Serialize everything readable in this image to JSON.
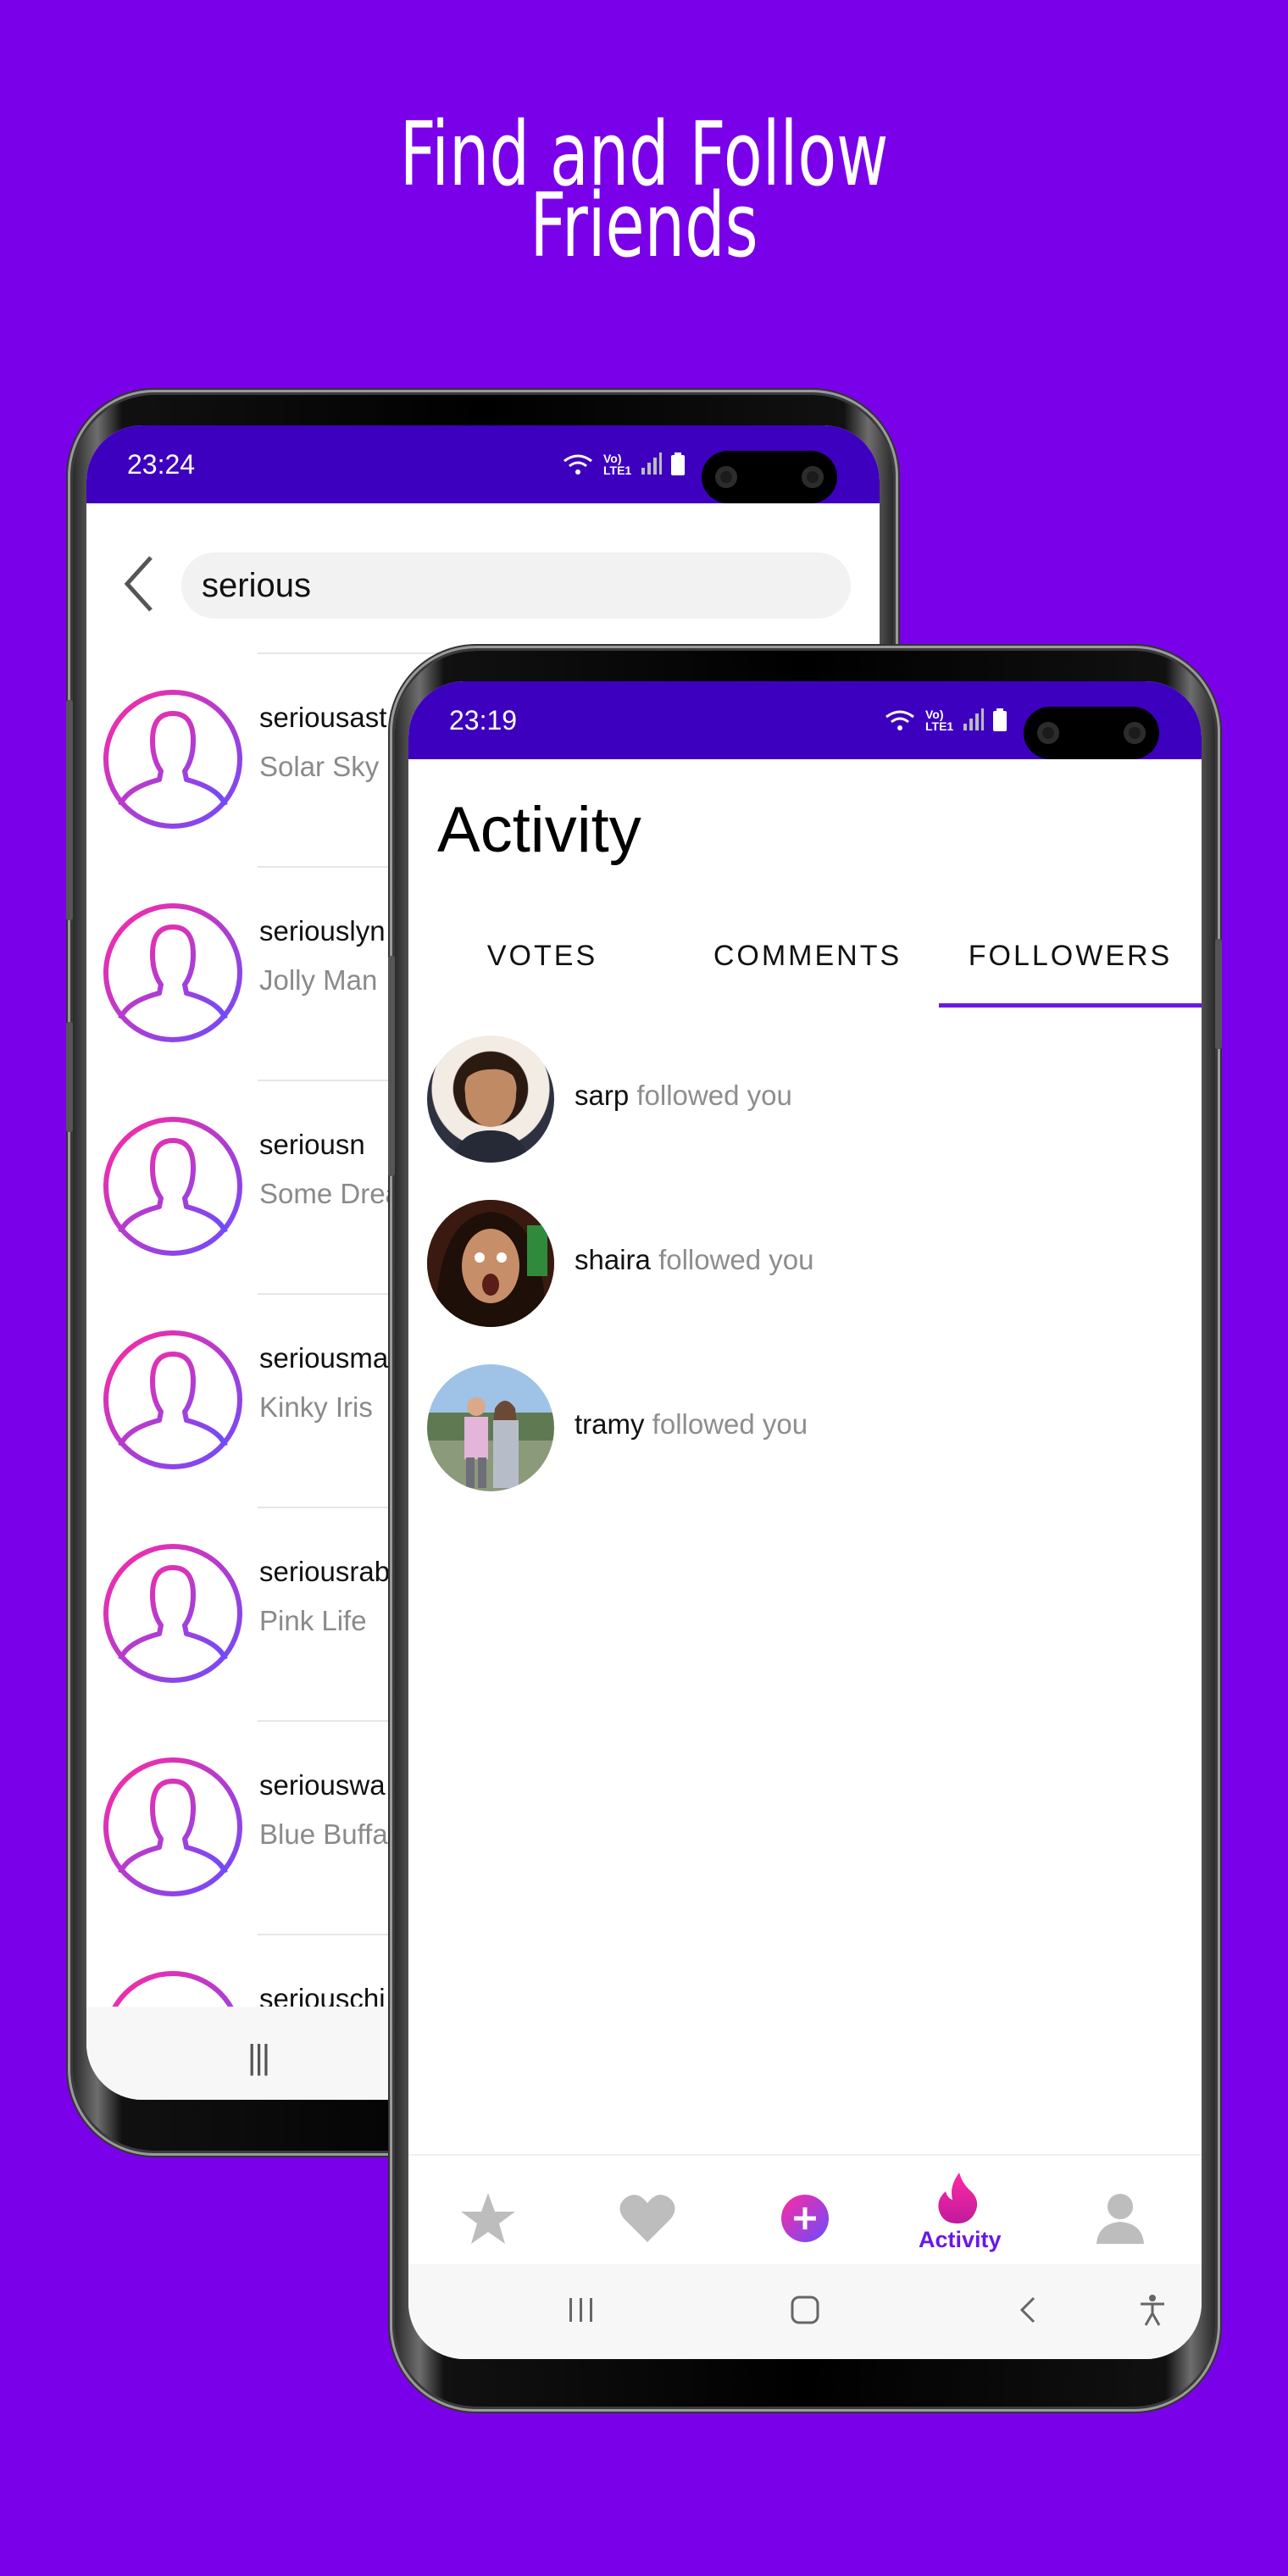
{
  "headline": {
    "line1": "Find and Follow",
    "line2": "Friends"
  },
  "back_phone": {
    "status_time": "23:24",
    "search": {
      "value": "serious"
    },
    "results": [
      {
        "username": "seriousast",
        "fullname": "Solar Sky"
      },
      {
        "username": "seriouslyn",
        "fullname": "Jolly Man"
      },
      {
        "username": "seriousn",
        "fullname": "Some Drea"
      },
      {
        "username": "seriousma",
        "fullname": "Kinky Iris"
      },
      {
        "username": "seriousrab",
        "fullname": "Pink Life"
      },
      {
        "username": "seriouswa",
        "fullname": "Blue Buffa"
      },
      {
        "username": "seriouschi",
        "fullname": ""
      }
    ],
    "nav_recent_glyph": "|||"
  },
  "front_phone": {
    "status_time": "23:19",
    "title": "Activity",
    "tabs": [
      {
        "label": "VOTES",
        "active": false
      },
      {
        "label": "COMMENTS",
        "active": false
      },
      {
        "label": "FOLLOWERS",
        "active": true
      }
    ],
    "followers": [
      {
        "name": "sarp",
        "action": "followed you"
      },
      {
        "name": "shaira",
        "action": "followed you"
      },
      {
        "name": "tramy",
        "action": "followed you"
      }
    ],
    "bottom_nav": [
      {
        "icon": "star-icon",
        "label": ""
      },
      {
        "icon": "heart-icon",
        "label": ""
      },
      {
        "icon": "plus-icon",
        "label": ""
      },
      {
        "icon": "flame-icon",
        "label": "Activity",
        "active": true
      },
      {
        "icon": "profile-icon",
        "label": ""
      }
    ],
    "system_nav": [
      "recent-apps-icon",
      "home-icon",
      "back-icon",
      "accessibility-icon"
    ]
  },
  "colors": {
    "background": "#7a00ea",
    "statusbar": "#3e00bf",
    "accent": "#6b17e8",
    "gradient_start": "#ff2aa0",
    "gradient_end": "#6a4cff"
  }
}
